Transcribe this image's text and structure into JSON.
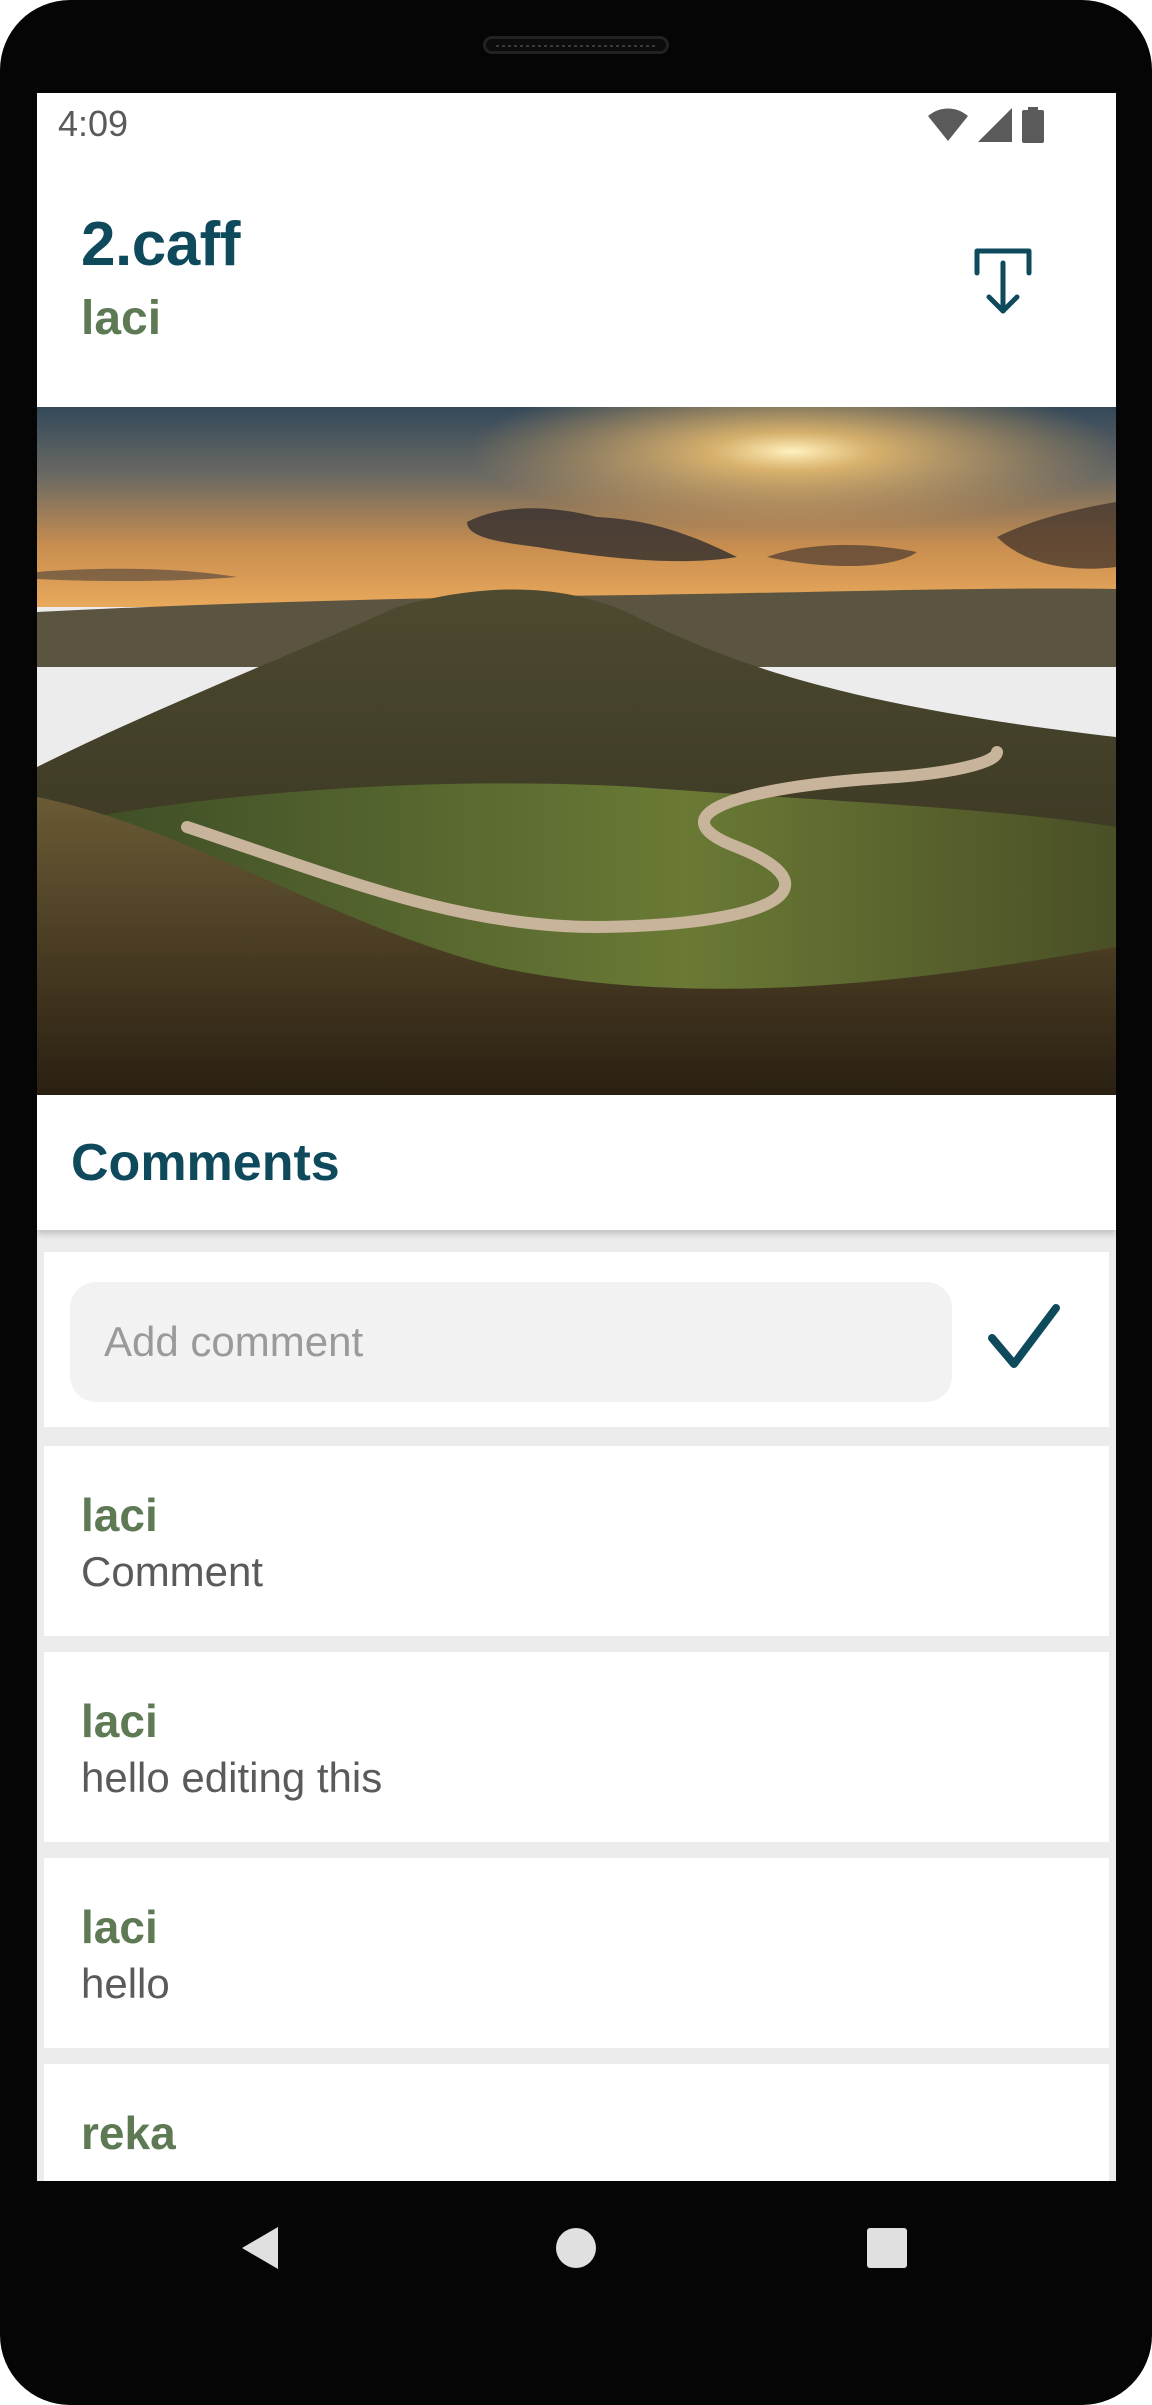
{
  "status_bar": {
    "time": "4:09",
    "icons": [
      "wifi-icon",
      "signal-icon",
      "battery-icon"
    ]
  },
  "header": {
    "title": "2.caff",
    "owner": "laci",
    "download_icon": "download-icon"
  },
  "image": {
    "subject": "landscape-photo"
  },
  "comments": {
    "title": "Comments",
    "input_placeholder": "Add comment",
    "input_value": "",
    "submit_icon": "check-icon",
    "items": [
      {
        "author": "laci",
        "text": "Comment"
      },
      {
        "author": "laci",
        "text": "hello editing this"
      },
      {
        "author": "laci",
        "text": "hello"
      },
      {
        "author": "reka",
        "text": ""
      }
    ]
  },
  "nav_bar": {
    "buttons": [
      "back-icon",
      "home-icon",
      "recents-icon"
    ]
  },
  "colors": {
    "title": "#0e4a5c",
    "accent_green": "#5e7a55",
    "background": "#ececec",
    "input_bg": "#f2f2f2"
  }
}
